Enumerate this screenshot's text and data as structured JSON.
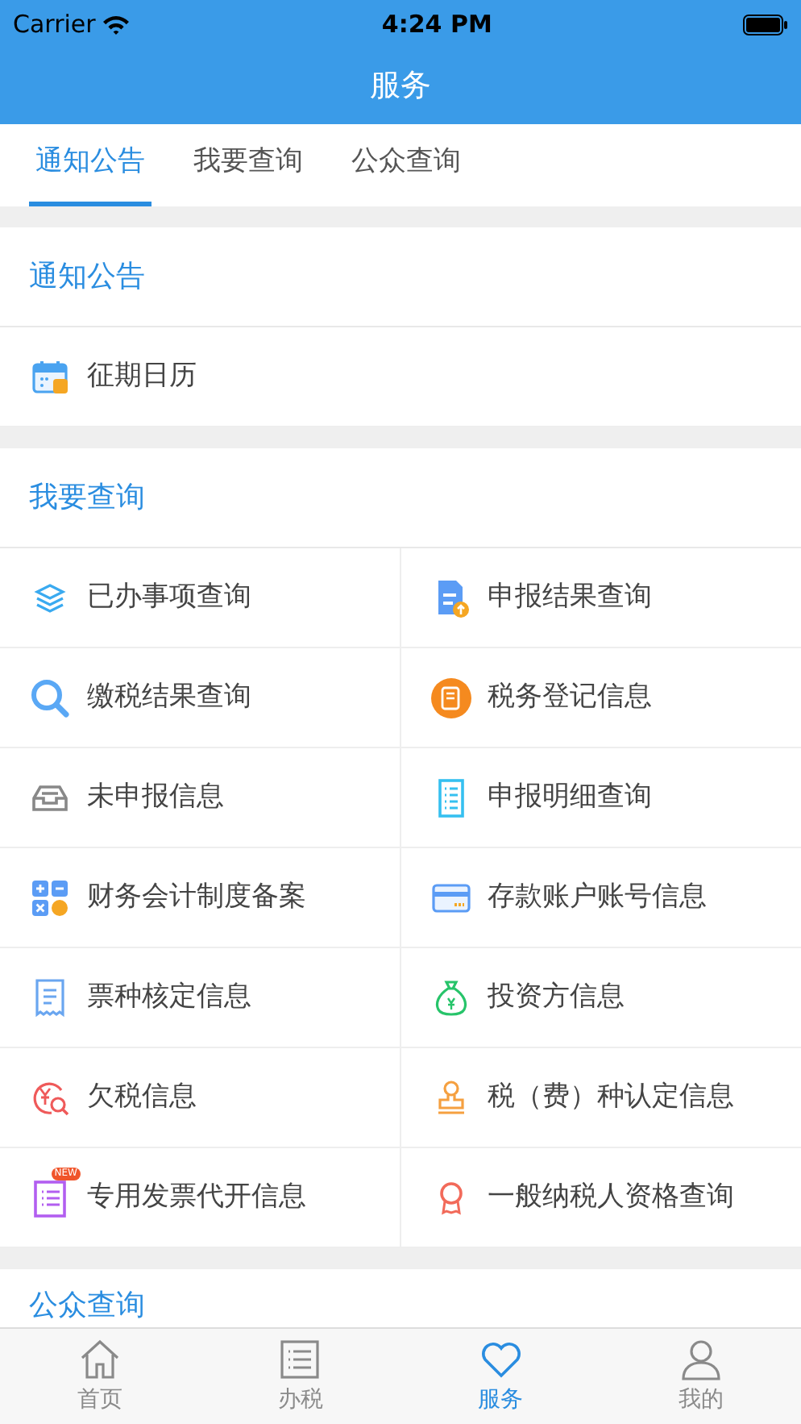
{
  "status_bar": {
    "carrier": "Carrier",
    "time": "4:24 PM"
  },
  "nav_bar": {
    "title": "服务"
  },
  "tabs": [
    {
      "label": "通知公告",
      "selected": true
    },
    {
      "label": "我要查询",
      "selected": false
    },
    {
      "label": "公众查询",
      "selected": false
    }
  ],
  "sections": [
    {
      "title": "通知公告",
      "kind": "list",
      "items": [
        {
          "label": "征期日历"
        }
      ]
    },
    {
      "title": "我要查询",
      "kind": "grid",
      "items": [
        {
          "label": "已办事项查询"
        },
        {
          "label": "申报结果查询"
        },
        {
          "label": "缴税结果查询"
        },
        {
          "label": "税务登记信息"
        },
        {
          "label": "未申报信息"
        },
        {
          "label": "申报明细查询"
        },
        {
          "label": "财务会计制度备案"
        },
        {
          "label": "存款账户账号信息"
        },
        {
          "label": "票种核定信息"
        },
        {
          "label": "投资方信息"
        },
        {
          "label": "欠税信息"
        },
        {
          "label": "税（费）种认定信息"
        },
        {
          "label": "专用发票代开信息",
          "badge": "NEW"
        },
        {
          "label": "一般纳税人资格查询"
        }
      ]
    },
    {
      "title": "公众查询",
      "kind": "grid"
    }
  ],
  "tab_bar": [
    {
      "label": "首页",
      "selected": false
    },
    {
      "label": "办税",
      "selected": false
    },
    {
      "label": "服务",
      "selected": true
    },
    {
      "label": "我的",
      "selected": false
    }
  ]
}
